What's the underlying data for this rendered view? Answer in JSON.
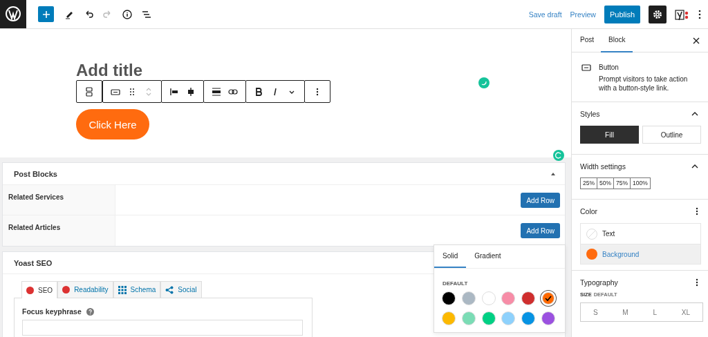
{
  "top_bar": {
    "save_draft": "Save draft",
    "preview": "Preview",
    "publish": "Publish"
  },
  "editor": {
    "title_placeholder": "Add title",
    "button_text": "Click Here"
  },
  "post_blocks": {
    "title": "Post Blocks",
    "rows": [
      {
        "label": "Related Services",
        "button": "Add Row"
      },
      {
        "label": "Related Articles",
        "button": "Add Row"
      }
    ]
  },
  "yoast": {
    "title": "Yoast SEO",
    "tabs": [
      {
        "label": "SEO",
        "kind": "dot",
        "color": "#dc3232",
        "selected": true
      },
      {
        "label": "Readability",
        "kind": "dot",
        "color": "#dc3232",
        "selected": false
      },
      {
        "label": "Schema",
        "kind": "grid",
        "selected": false
      },
      {
        "label": "Social",
        "kind": "share",
        "selected": false
      }
    ],
    "focus_keyphrase_label": "Focus keyphrase"
  },
  "color_popover": {
    "tabs": [
      {
        "label": "Solid",
        "selected": true
      },
      {
        "label": "Gradient",
        "selected": false
      }
    ],
    "section_label": "DEFAULT",
    "swatches": [
      {
        "color": "#000000",
        "selected": false
      },
      {
        "color": "#abb8c3",
        "selected": false
      },
      {
        "color": "#ffffff",
        "selected": false
      },
      {
        "color": "#f78da7",
        "selected": false
      },
      {
        "color": "#cf2e2e",
        "selected": false
      },
      {
        "color": "#ff6900",
        "selected": true
      },
      {
        "color": "#fcb900",
        "selected": false
      },
      {
        "color": "#7bdcb5",
        "selected": false
      },
      {
        "color": "#00d084",
        "selected": false
      },
      {
        "color": "#8ed1fc",
        "selected": false
      },
      {
        "color": "#0693e3",
        "selected": false
      },
      {
        "color": "#9b51e0",
        "selected": false
      }
    ]
  },
  "sidebar": {
    "tabs": [
      {
        "label": "Post",
        "selected": false
      },
      {
        "label": "Block",
        "selected": true
      }
    ],
    "block": {
      "name": "Button",
      "description": "Prompt visitors to take action with a button-style link."
    },
    "styles": {
      "title": "Styles",
      "expanded": true,
      "options": [
        {
          "label": "Fill",
          "selected": true
        },
        {
          "label": "Outline",
          "selected": false
        }
      ]
    },
    "width_settings": {
      "title": "Width settings",
      "expanded": true,
      "options": [
        "25%",
        "50%",
        "75%",
        "100%"
      ]
    },
    "color": {
      "title": "Color",
      "items": [
        {
          "label": "Text",
          "kind": "empty",
          "selected": false
        },
        {
          "label": "Background",
          "kind": "swatch",
          "color": "#ff6b0f",
          "selected": true
        }
      ]
    },
    "typography": {
      "title": "Typography",
      "size_label": "SIZE",
      "size_value": "DEFAULT",
      "sizes": [
        "S",
        "M",
        "L",
        "XL"
      ]
    }
  }
}
